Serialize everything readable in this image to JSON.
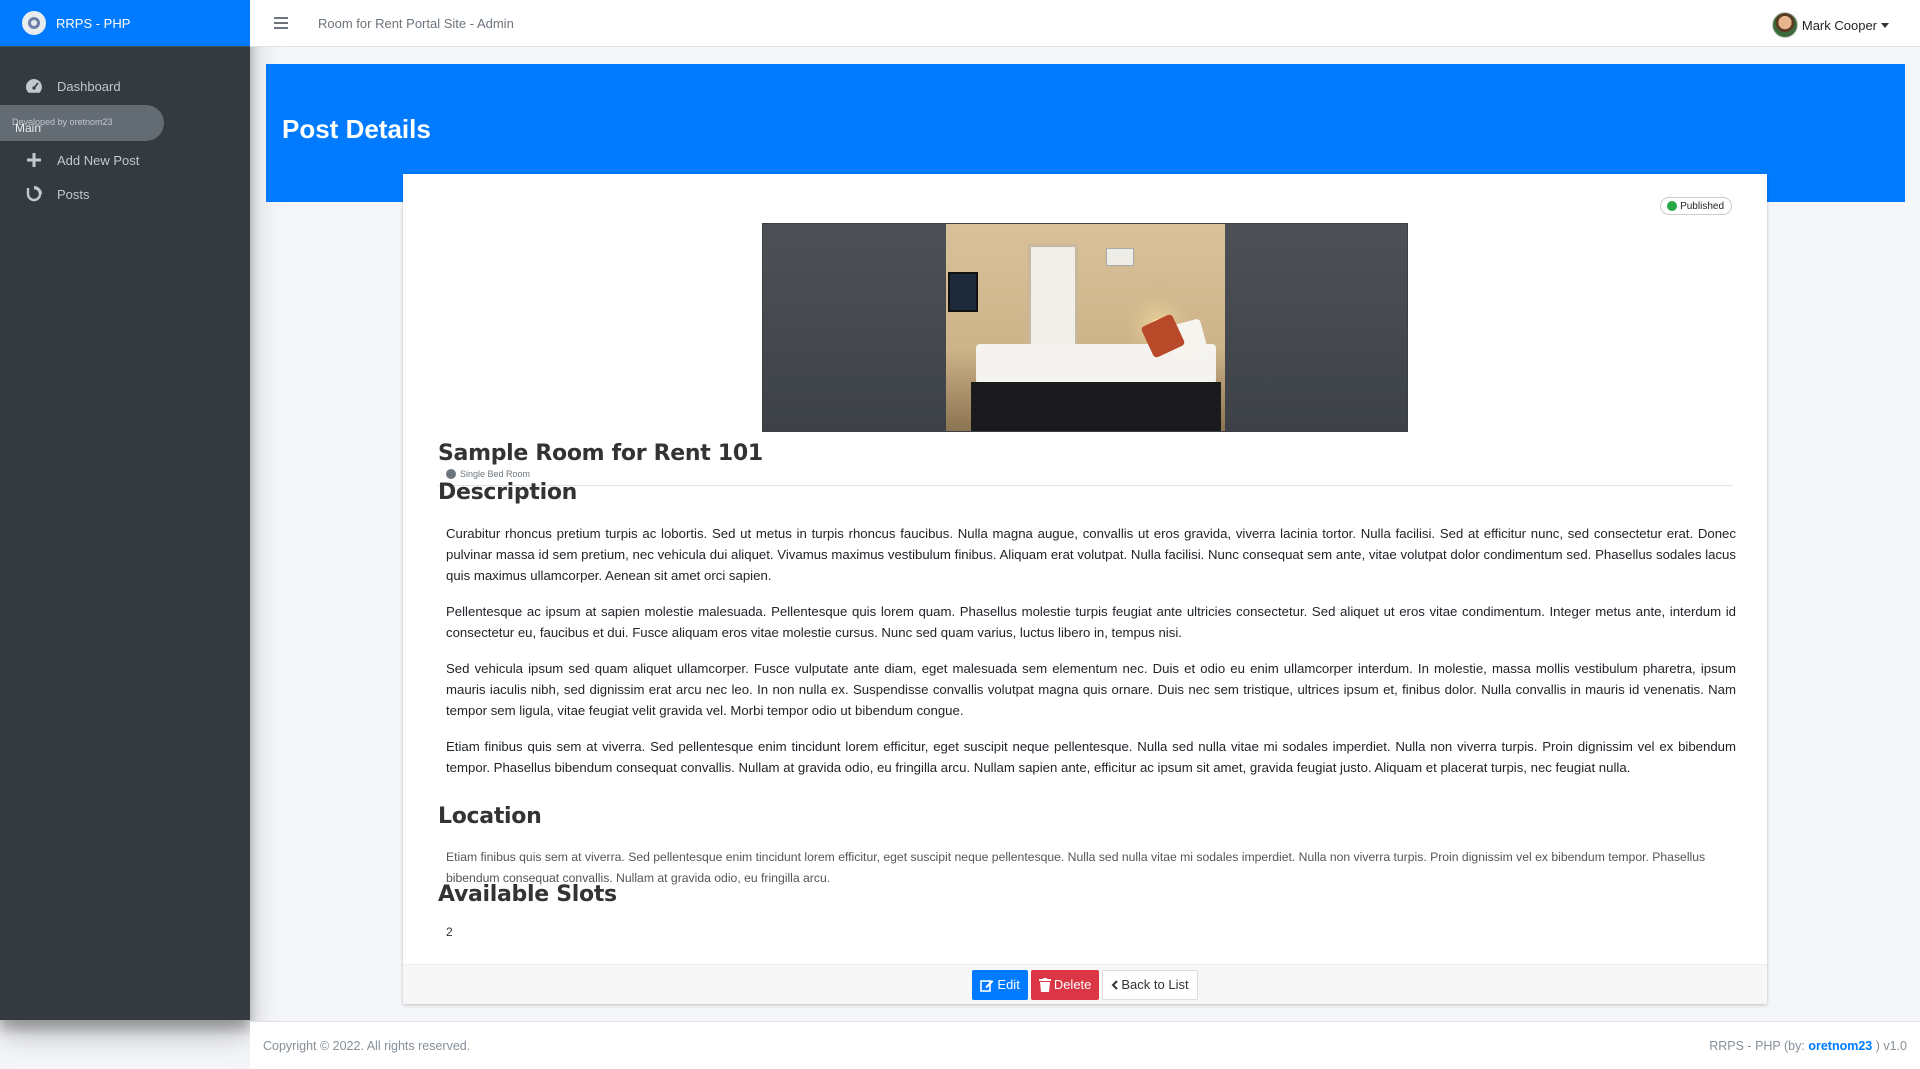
{
  "brand": {
    "name": "RRPS - PHP"
  },
  "sidebar": {
    "items": [
      {
        "label": "Dashboard",
        "icon": "tachometer-icon"
      }
    ],
    "header_overlay": "Developed by oretnom23",
    "header_label": "Main",
    "main_items": [
      {
        "label": "Add New Post",
        "icon": "plus-icon"
      },
      {
        "label": "Posts",
        "icon": "blog-icon"
      }
    ]
  },
  "topbar": {
    "site_title": "Room for Rent Portal Site - Admin",
    "user_name": "Mark Cooper"
  },
  "page": {
    "title": "Post Details"
  },
  "post": {
    "status": "Published",
    "status_color": "#28a745",
    "title": "Sample Room for Rent 101",
    "room_type": "Single Bed Room",
    "description_heading": "Description",
    "description": [
      "Curabitur rhoncus pretium turpis ac lobortis. Sed ut metus in turpis rhoncus faucibus. Nulla magna augue, convallis ut eros gravida, viverra lacinia tortor. Nulla facilisi. Sed at efficitur nunc, sed consectetur erat. Donec pulvinar massa id sem pretium, nec vehicula dui aliquet. Vivamus maximus vestibulum finibus. Aliquam erat volutpat. Nulla facilisi. Nunc consequat sem ante, vitae volutpat dolor condimentum sed. Phasellus sodales lacus quis maximus ullamcorper. Aenean sit amet orci sapien.",
      "Pellentesque ac ipsum at sapien molestie malesuada. Pellentesque quis lorem quam. Phasellus molestie turpis feugiat ante ultricies consectetur. Sed aliquet ut eros vitae condimentum. Integer metus ante, interdum id consectetur eu, faucibus et dui. Fusce aliquam eros vitae molestie cursus. Nunc sed quam varius, luctus libero in, tempus nisi.",
      "Sed vehicula ipsum sed quam aliquet ullamcorper. Fusce vulputate ante diam, eget malesuada sem elementum nec. Duis et odio eu enim ullamcorper interdum. In molestie, massa mollis vestibulum pharetra, ipsum mauris iaculis nibh, sed dignissim erat arcu nec leo. In non nulla ex. Suspendisse convallis volutpat magna quis ornare. Duis nec sem tristique, ultrices ipsum et, finibus dolor. Nulla convallis in mauris id venenatis. Nam tempor sem ligula, vitae feugiat velit gravida vel. Morbi tempor odio ut bibendum congue.",
      "Etiam finibus quis sem at viverra. Sed pellentesque enim tincidunt lorem efficitur, eget suscipit neque pellentesque. Nulla sed nulla vitae mi sodales imperdiet. Nulla non viverra turpis. Proin dignissim vel ex bibendum tempor. Phasellus bibendum consequat convallis. Nullam at gravida odio, eu fringilla arcu. Nullam sapien ante, efficitur ac ipsum sit amet, gravida feugiat justo. Aliquam et placerat turpis, nec feugiat nulla."
    ],
    "location_heading": "Location",
    "location": "Etiam finibus quis sem at viverra. Sed pellentesque enim tincidunt lorem efficitur, eget suscipit neque pellentesque. Nulla sed nulla vitae mi sodales imperdiet. Nulla non viverra turpis. Proin dignissim vel ex bibendum tempor. Phasellus bibendum consequat convallis. Nullam at gravida odio, eu fringilla arcu.",
    "slots_heading": "Available Slots",
    "slots": "2"
  },
  "actions": {
    "edit_label": "Edit",
    "delete_label": "Delete",
    "back_label": "Back to List"
  },
  "footer": {
    "copyright": "Copyright © 2022. All rights reserved.",
    "credit_prefix": "RRPS - PHP (by: ",
    "credit_author": "oretnom23",
    "credit_suffix": " ) v1.0"
  },
  "colors": {
    "primary": "#007bff",
    "danger": "#dc3545",
    "sidebar": "#343a40"
  }
}
